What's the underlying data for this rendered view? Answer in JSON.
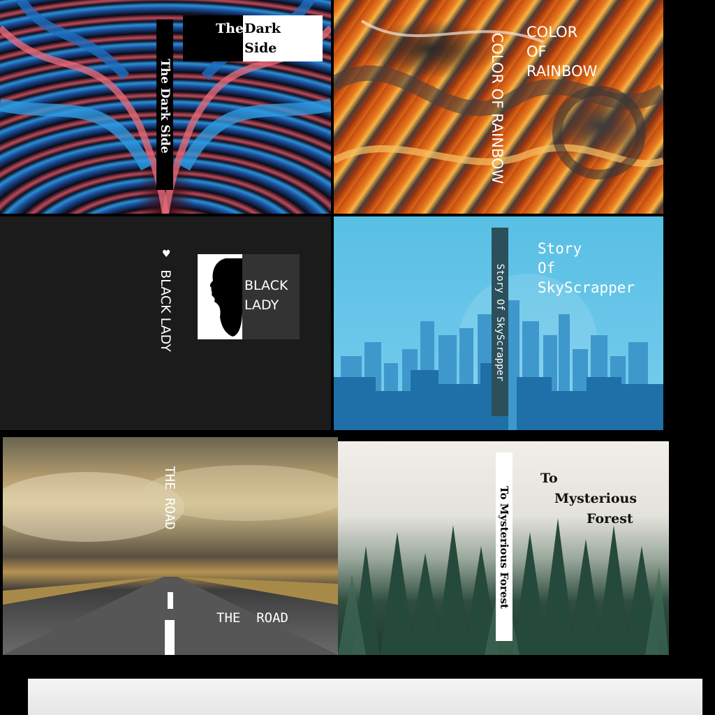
{
  "covers": {
    "dark_side": {
      "spine": "The Dark Side",
      "title_a": "The",
      "title_b": "Dark",
      "title_c": "Side"
    },
    "rainbow": {
      "spine": "COLOR OF RAINBOW",
      "title_1": "COLOR",
      "title_2": "OF",
      "title_3": "RAINBOW"
    },
    "black_lady": {
      "spine": "BLACK LADY",
      "title_1": "BLACK",
      "title_2": "LADY"
    },
    "skyscrapper": {
      "spine": "Story Of SkyScrapper",
      "title_1": "Story",
      "title_2": "Of",
      "title_3": "SkyScrapper"
    },
    "road": {
      "spine": "THE  ROAD",
      "title": "THE  ROAD"
    },
    "forest": {
      "spine": "To Mysterious Forest",
      "title_1": "To",
      "title_2": "Mysterious",
      "title_3": "Forest"
    }
  },
  "colors": {
    "background": "#000000",
    "sky_blue": "#5ec3e8",
    "dark_panel": "#1b1b1b"
  }
}
